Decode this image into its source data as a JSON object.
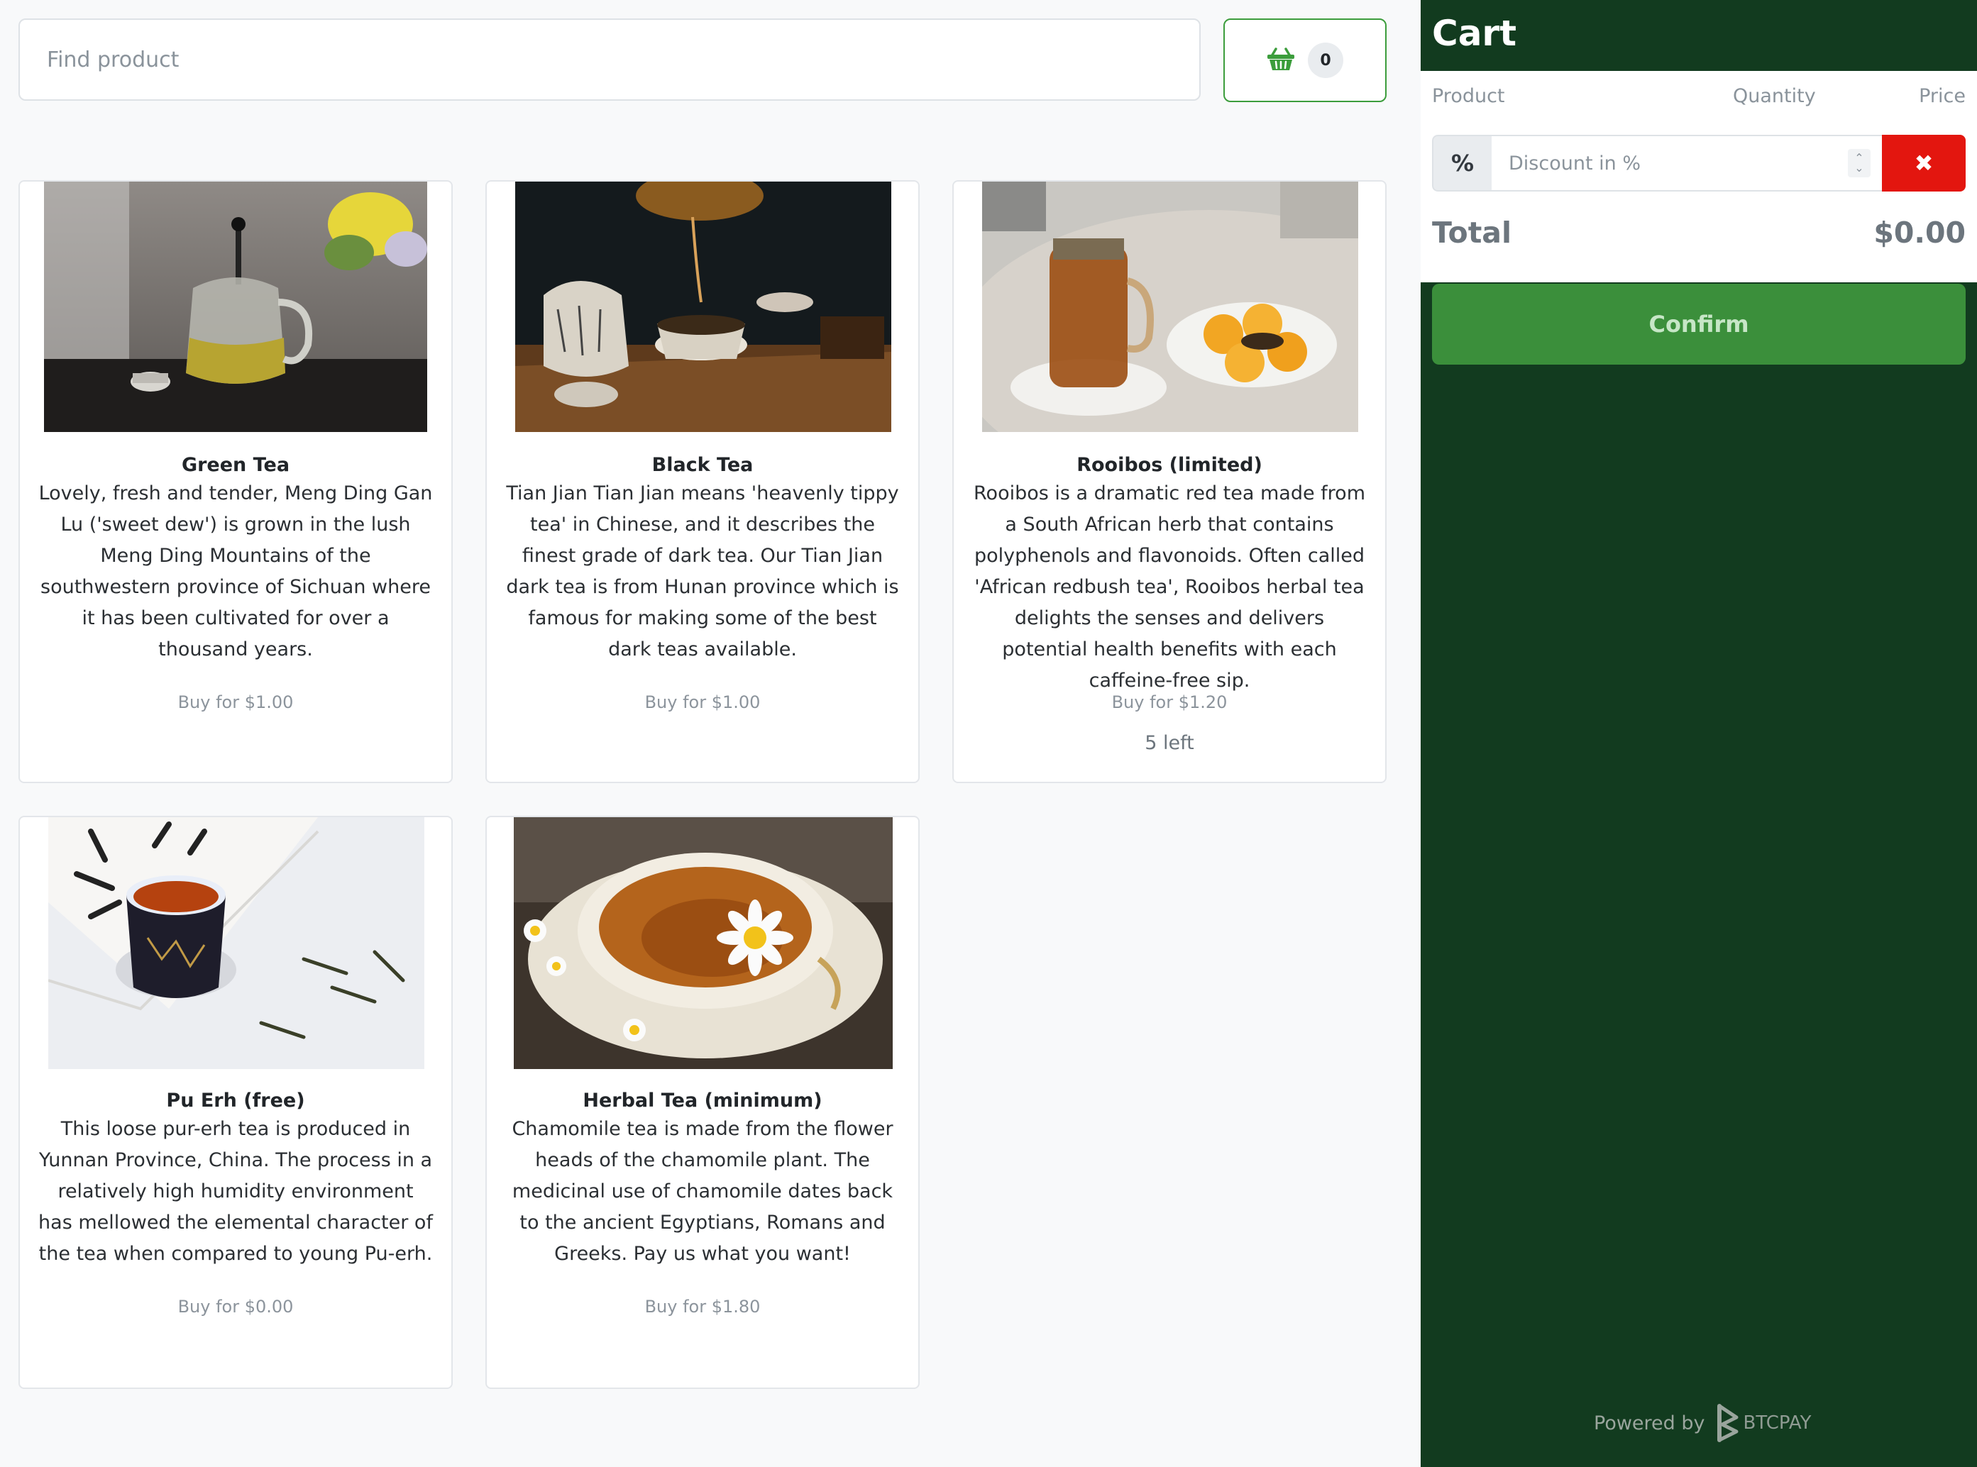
{
  "search": {
    "placeholder": "Find product"
  },
  "basket": {
    "count": "0",
    "icon": "basket-icon"
  },
  "products": [
    {
      "title": "Green Tea",
      "description": "Lovely, fresh and tender, Meng Ding Gan Lu ('sweet dew') is grown in the lush Meng Ding Mountains of the southwestern province of Sichuan where it has been cultivated for over a thousand years.",
      "price": "Buy for $1.00",
      "stock": ""
    },
    {
      "title": "Black Tea",
      "description": "Tian Jian Tian Jian means 'heavenly tippy tea' in Chinese, and it describes the finest grade of dark tea. Our Tian Jian dark tea is from Hunan province which is famous for making some of the best dark teas available.",
      "price": "Buy for $1.00",
      "stock": ""
    },
    {
      "title": "Rooibos (limited)",
      "description": "Rooibos is a dramatic red tea made from a South African herb that contains polyphenols and flavonoids. Often called 'African redbush tea', Rooibos herbal tea delights the senses and delivers potential health benefits with each caffeine-free sip.",
      "price": "Buy for $1.20",
      "stock": "5 left"
    },
    {
      "title": "Pu Erh (free)",
      "description": "This loose pur-erh tea is produced in Yunnan Province, China. The process in a relatively high humidity environment has mellowed the elemental character of the tea when compared to young Pu-erh.",
      "price": "Buy for $0.00",
      "stock": ""
    },
    {
      "title": "Herbal Tea (minimum)",
      "description": "Chamomile tea is made from the flower heads of the chamomile plant. The medicinal use of chamomile dates back to the ancient Egyptians, Romans and Greeks. Pay us what you want!",
      "price": "Buy for $1.80",
      "stock": ""
    }
  ],
  "cart": {
    "title": "Cart",
    "columns": {
      "product": "Product",
      "quantity": "Quantity",
      "price": "Price"
    },
    "discount": {
      "prefix": "%",
      "placeholder": "Discount in %",
      "clear_icon": "close-icon"
    },
    "total_label": "Total",
    "total_value": "$0.00",
    "confirm_label": "Confirm",
    "powered_by": "Powered by",
    "brand": "BTCPAY"
  },
  "colors": {
    "sidebar": "#123b1f",
    "accent": "#3b8f3b",
    "danger": "#e3160f"
  }
}
